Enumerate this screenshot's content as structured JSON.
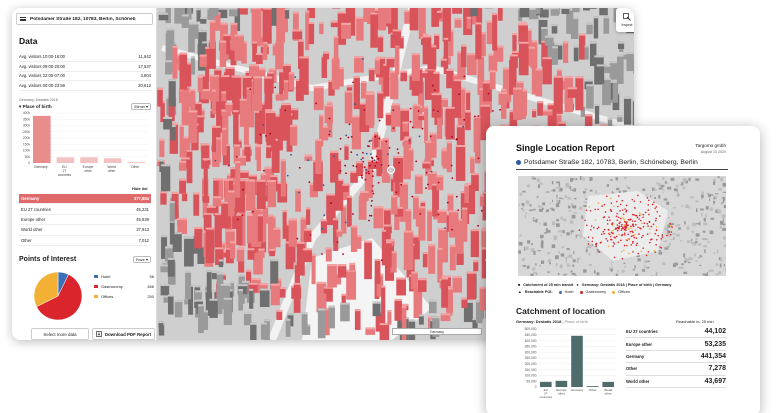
{
  "app": {
    "search_value": "Potsdamer Straße 182, 10783, Berlin, Schöneb",
    "data_title": "Data",
    "visits": [
      {
        "label": "Avg. visitors 10:00-16:00",
        "value": "11,642"
      },
      {
        "label": "Avg. visitors 09:00-20:00",
        "value": "17,537"
      },
      {
        "label": "Avg. visitors 22:00-07:00",
        "value": "3,804"
      },
      {
        "label": "Avg. visitors 00:00-23:59",
        "value": "20,612"
      }
    ],
    "filter": {
      "sub": "Germany: Destatis 2018",
      "label": "Place of birth",
      "time": "25min"
    },
    "mini_chart": {
      "y_ticks": [
        "400k",
        "350k",
        "300k",
        "250k",
        "200k",
        "150k",
        "100k",
        "50k",
        "0"
      ],
      "categories": [
        "Germany",
        "EU 27 countries",
        "Europe other",
        "World other",
        "Other"
      ],
      "values": [
        377,
        45,
        46,
        38,
        7
      ],
      "ymax": 400
    },
    "hide_label": "Hide list",
    "origins": [
      {
        "label": "Germany",
        "value": "377,884"
      },
      {
        "label": "EU 27 countries",
        "value": "45,231"
      },
      {
        "label": "Europe other",
        "value": "45,839"
      },
      {
        "label": "World other",
        "value": "37,913"
      },
      {
        "label": "Other",
        "value": "7,012"
      }
    ],
    "poi": {
      "title": "Points of Interest",
      "select": "Fave",
      "items": [
        {
          "label": "Hotel",
          "value": "56",
          "color": "#3b6fb6"
        },
        {
          "label": "Gastronomy",
          "value": "466",
          "color": "#d9252b"
        },
        {
          "label": "Offices",
          "value": "250",
          "color": "#f2b134"
        }
      ]
    },
    "buttons": {
      "more": "Select more data",
      "pdf": "Download PDF Report"
    },
    "inspect_label": "Inspect",
    "scale_label": "Germany"
  },
  "report": {
    "title": "Single Location Report",
    "company": "Targomo gmbh",
    "date": "August 10 2020",
    "address": "Potsdamer Straße 182, 10783, Berlin, Schöneberg, Berlin",
    "caption_line1": "Catchment of 25 min transit",
    "caption_line1b": "Germany: Destatis 2018 | Place of birth | Germany",
    "caption_reachable": "Reachable POI:",
    "caption_items": [
      {
        "label": "Hotel",
        "color": "#3b6fb6"
      },
      {
        "label": "Gastronomy",
        "color": "#d9252b"
      },
      {
        "label": "Offices",
        "color": "#f2b134"
      }
    ],
    "section_title": "Catchment of location",
    "sub_left": "Germany: Destatis 2018",
    "sub_left_b": "Place of birth",
    "sub_right": "Reachable in: 25 min",
    "chart": {
      "y_ticks": [
        "500,000",
        "450,000",
        "400,000",
        "350,000",
        "300,000",
        "250,000",
        "200,000",
        "150,000",
        "100,000",
        "50,000",
        "0"
      ],
      "categories": [
        "EU 27 countries",
        "Europe other",
        "Germany",
        "Other",
        "World other"
      ],
      "values": [
        44102,
        53235,
        441354,
        7278,
        43697
      ],
      "ymax": 500000
    },
    "list": [
      {
        "label": "EU 27 countries",
        "value": "44,102"
      },
      {
        "label": "Europe other",
        "value": "53,235"
      },
      {
        "label": "Germany",
        "value": "441,354"
      },
      {
        "label": "Other",
        "value": "7,278"
      },
      {
        "label": "World other",
        "value": "43,697"
      }
    ]
  }
}
